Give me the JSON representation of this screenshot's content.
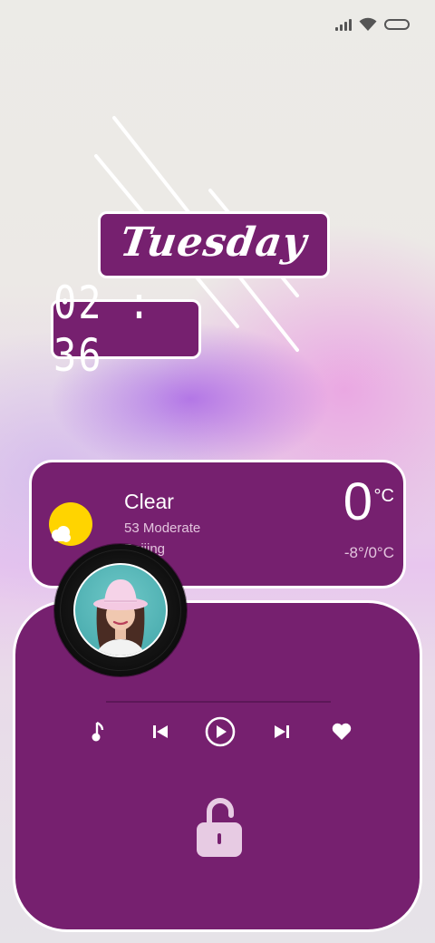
{
  "status_bar": {
    "icons": [
      "signal-icon",
      "wifi-icon",
      "battery-icon"
    ]
  },
  "lockscreen": {
    "day": "Tuesday",
    "time": "02 : 36"
  },
  "weather": {
    "condition": "Clear",
    "aqi": "53  Moderate",
    "city": "Beijing",
    "temperature": "0",
    "unit": "°C",
    "range": "-8°/0°C",
    "icon": "sun-cloud-icon"
  },
  "music": {
    "album_art": "album-art-portrait",
    "controls": [
      "music-note-icon",
      "previous-icon",
      "play-icon",
      "next-icon",
      "heart-icon"
    ]
  },
  "unlock": {
    "icon": "unlock-icon"
  },
  "colors": {
    "card_purple": "#76206f",
    "sun_yellow": "#ffd400",
    "secondary_text": "#e3c4de"
  }
}
